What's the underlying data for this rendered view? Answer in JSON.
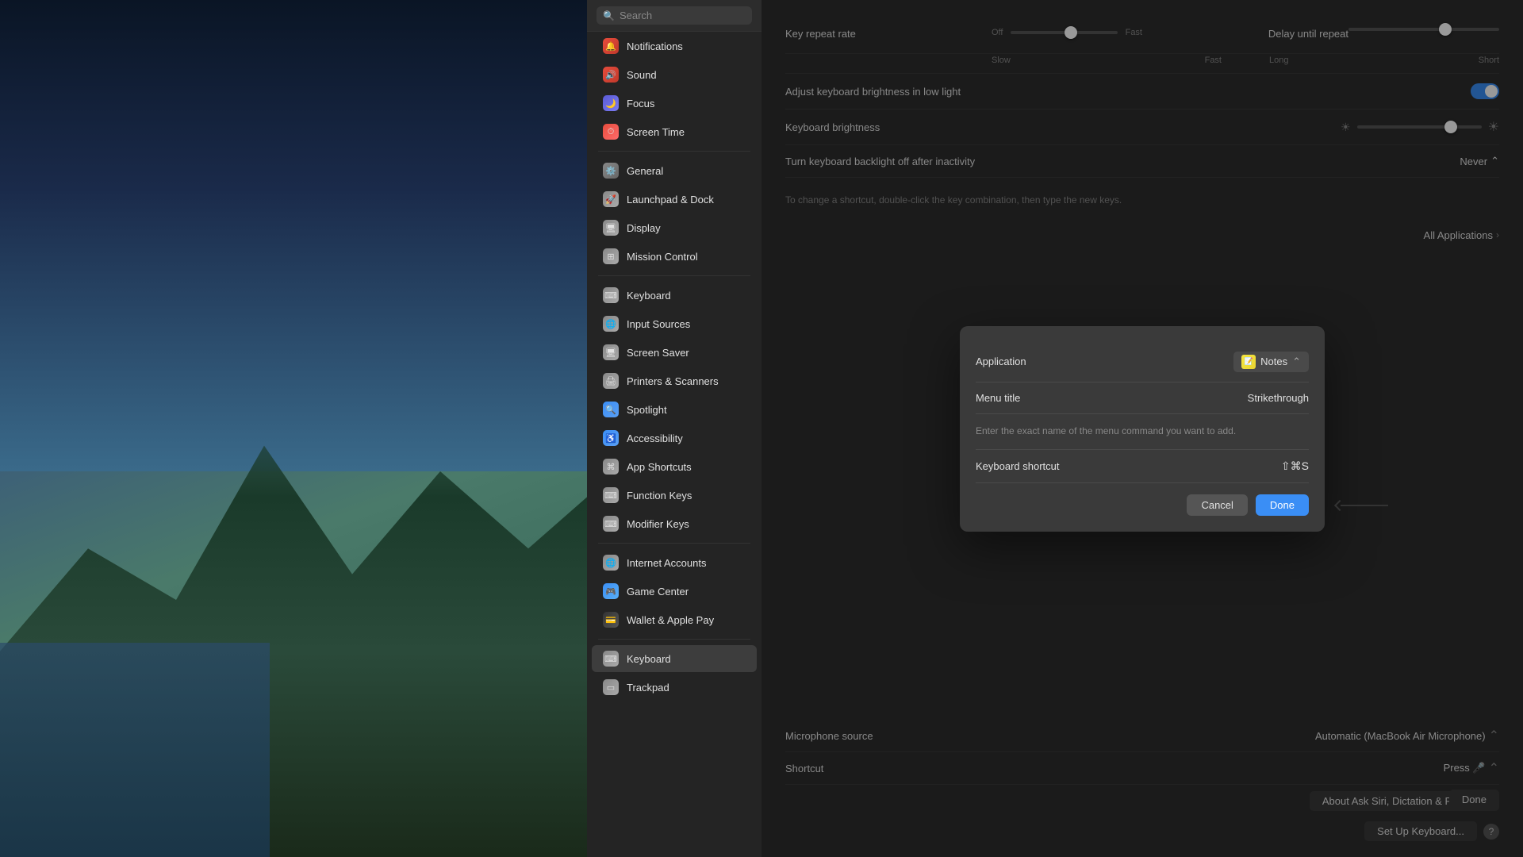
{
  "desktop": {
    "alt": "macOS mountain wallpaper"
  },
  "sidebar": {
    "search_placeholder": "Search",
    "items_top": [
      {
        "id": "notifications",
        "label": "Notifications",
        "icon": "notifications",
        "active": false
      },
      {
        "id": "sound",
        "label": "Sound",
        "icon": "sound",
        "active": false
      },
      {
        "id": "focus",
        "label": "Focus",
        "icon": "focus",
        "active": false
      },
      {
        "id": "screentime",
        "label": "Screen Time",
        "icon": "screentime",
        "active": false
      }
    ],
    "items_mid": [
      {
        "id": "general",
        "label": "General",
        "icon": "general",
        "active": false
      },
      {
        "id": "launchpad",
        "label": "Launchpad & Dock",
        "icon": "launchpad",
        "active": false
      },
      {
        "id": "display",
        "label": "Display",
        "icon": "display",
        "active": false
      },
      {
        "id": "mission",
        "label": "Mission Control",
        "icon": "mission",
        "active": false
      }
    ],
    "items_keyboard": [
      {
        "id": "keyboard",
        "label": "Keyboard",
        "icon": "keyboard",
        "active": false
      },
      {
        "id": "input",
        "label": "Input Sources",
        "icon": "input",
        "active": false
      },
      {
        "id": "screen2",
        "label": "Screen Saver",
        "icon": "screen",
        "active": false
      },
      {
        "id": "printers",
        "label": "Printers & Scanners",
        "icon": "printers",
        "active": false
      },
      {
        "id": "spotlight",
        "label": "Spotlight",
        "icon": "spotlight",
        "active": false
      },
      {
        "id": "accessibility",
        "label": "Accessibility",
        "icon": "accessibility",
        "active": false
      },
      {
        "id": "appshortcuts",
        "label": "App Shortcuts",
        "icon": "appshortcuts",
        "active": false
      },
      {
        "id": "functionkeys",
        "label": "Function Keys",
        "icon": "functionkeys",
        "active": false
      },
      {
        "id": "modifierkeys",
        "label": "Modifier Keys",
        "icon": "modifierkeys",
        "active": false
      }
    ],
    "items_bottom": [
      {
        "id": "internet",
        "label": "Internet Accounts",
        "icon": "internet",
        "active": false
      },
      {
        "id": "gamecenter",
        "label": "Game Center",
        "icon": "gamecenter",
        "active": false
      },
      {
        "id": "wallet",
        "label": "Wallet & Apple Pay",
        "icon": "wallet",
        "active": false
      }
    ],
    "items_devices": [
      {
        "id": "keyboard-main",
        "label": "Keyboard",
        "icon": "keyboard-main",
        "active": true
      },
      {
        "id": "trackpad",
        "label": "Trackpad",
        "icon": "trackpad",
        "active": false
      }
    ]
  },
  "main": {
    "key_repeat_rate_label": "Key repeat rate",
    "delay_until_repeat_label": "Delay until repeat",
    "off_label": "Off",
    "slow_label": "Slow",
    "fast_label": "Fast",
    "long_label": "Long",
    "short_label": "Short",
    "brightness_label": "Adjust keyboard brightness in low light",
    "kb_brightness_label": "Keyboard brightness",
    "backlight_label": "Turn keyboard backlight off after inactivity",
    "never_label": "Never",
    "shortcut_instruction": "To change a shortcut, double-click the key combination, then type the new keys.",
    "all_applications": "All Applications",
    "shortcut_label": "Shortcut",
    "press_label": "Press 🎤",
    "about_siri_btn": "About Ask Siri, Dictation & Privacy...",
    "setup_keyboard_btn": "Set Up Keyboard...",
    "done_label": "Done",
    "microphone_source_label": "Microphone source",
    "microphone_source_value": "Automatic (MacBook Air Microphone)"
  },
  "modal": {
    "title": "Application",
    "app_name": "Notes",
    "app_icon": "📝",
    "menu_title_label": "Menu title",
    "menu_title_value": "Strikethrough",
    "menu_title_placeholder": "Strikethrough",
    "instruction": "Enter the exact name of the menu command you want to add.",
    "keyboard_shortcut_label": "Keyboard shortcut",
    "keyboard_shortcut_value": "⇧⌘S",
    "cancel_label": "Cancel",
    "done_label": "Done"
  }
}
